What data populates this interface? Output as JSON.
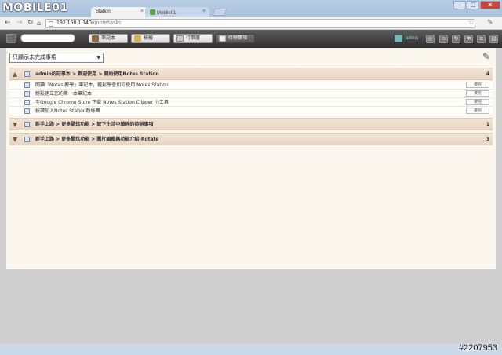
{
  "watermark": {
    "logo": "MOBILE01",
    "id": "#2207953"
  },
  "browser": {
    "tabs": [
      {
        "title": "Station",
        "active": true
      },
      {
        "title": "Mobile01",
        "active": false
      }
    ],
    "address": {
      "host": "192.168.1.140",
      "path": "/qnote/tasks"
    },
    "icons": [
      "back-icon",
      "forward-icon",
      "reload-icon",
      "star-icon",
      "wrench-icon"
    ]
  },
  "toolbar": {
    "buttons": [
      {
        "label": "筆記本"
      },
      {
        "label": "標籤"
      },
      {
        "label": "行事曆"
      },
      {
        "label": "待辦事項",
        "selected": true
      }
    ],
    "user": "admin",
    "colors": {
      "toolbar_bg": "#3a3a3a",
      "selected_btn": "#5a5a5a"
    }
  },
  "tasks": {
    "filter": "只顯示未完成事項",
    "done_label": "被完",
    "groups": [
      {
        "path": "admin的記事本 > 歡迎使用 > 開始使用Notes Station",
        "count": "4",
        "expanded": true,
        "items": [
          "閱讀「Notes 教學」筆記本，輕鬆學會如何使用 Notes Station",
          "輕鬆建立您的第一本筆記本",
          "至Google Chrome Store 下載 Notes Station Clipper 小工具",
          "按讚加入Notes Station粉絲團"
        ]
      },
      {
        "path": "新手上路 > 更多酷炫功能 > 記下生活中瑣碎的待辦事項",
        "count": "1",
        "expanded": false,
        "items": []
      },
      {
        "path": "新手上路 > 更多酷炫功能 > 圖片編輯器功能介紹-Rotate",
        "count": "3",
        "expanded": false,
        "items": []
      }
    ]
  }
}
